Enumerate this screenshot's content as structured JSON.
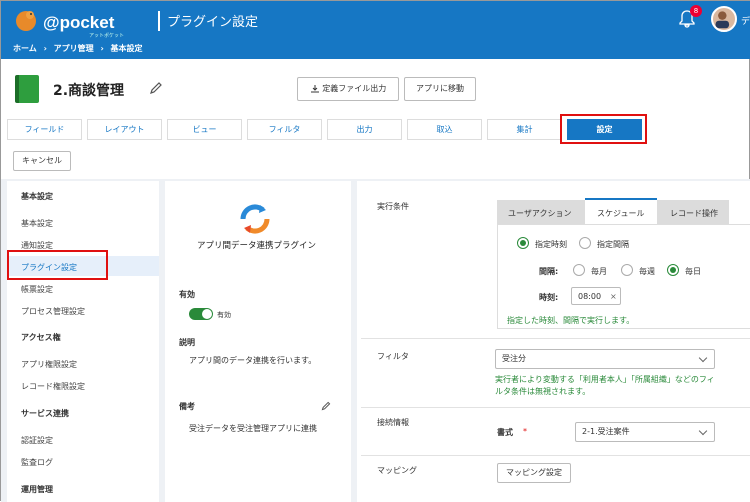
{
  "header": {
    "logo_text": "@pocket",
    "logo_sub": "アットポケット",
    "title": "プラグイン設定",
    "breadcrumb": [
      "ホーム",
      "›",
      "アプリ管理",
      "›",
      "基本設定"
    ],
    "notif_count": "8",
    "user_initial": "デ"
  },
  "app": {
    "name": "2.商談管理",
    "def_button": "定義ファイル出力",
    "goto_button": "アプリに移動"
  },
  "tabs": [
    "フィールド",
    "レイアウト",
    "ビュー",
    "フィルタ",
    "出力",
    "取込",
    "集計",
    "設定"
  ],
  "cancel_label": "キャンセル",
  "sidebar": {
    "s1": "基本設定",
    "i1": "基本設定",
    "i2": "通知設定",
    "i3": "プラグイン設定",
    "i4": "帳票設定",
    "i5": "プロセス管理設定",
    "s2": "アクセス権",
    "i6": "アプリ権限設定",
    "i7": "レコード権限設定",
    "s3": "サービス連携",
    "i8": "認証設定",
    "i9": "監査ログ",
    "s4": "運用管理"
  },
  "plugin": {
    "name": "アプリ間データ連携プラグイン",
    "enabled_label": "有効",
    "toggle_label": "有効",
    "desc_label": "説明",
    "desc": "アプリ間のデータ連携を行います。",
    "note_label": "備考",
    "note": "受注データを受注管理アプリに連携"
  },
  "exec": {
    "label": "実行条件",
    "tabs": [
      "ユーザアクション",
      "スケジュール",
      "レコード操作"
    ],
    "opt_time": "指定時刻",
    "opt_interval": "指定間隔",
    "interval_label": "間隔:",
    "monthly": "毎月",
    "weekly": "毎週",
    "daily": "毎日",
    "time_label": "時刻:",
    "time_value": "08:00",
    "time_clear": "×",
    "hint": "指定した時刻、間隔で実行します。"
  },
  "filter": {
    "label": "フィルタ",
    "value": "受注分",
    "hint": "実行者により変動する「利用者本人」「所属組織」などのフィルタ条件は無視されます。"
  },
  "conn": {
    "label": "接続情報",
    "format_label": "書式",
    "required": "*",
    "value": "2-1.受注案件"
  },
  "mapping": {
    "label": "マッピング",
    "button": "マッピング設定"
  },
  "colors": {
    "primary": "#1677c4",
    "green": "#2a8a3a",
    "red": "#e01010"
  }
}
